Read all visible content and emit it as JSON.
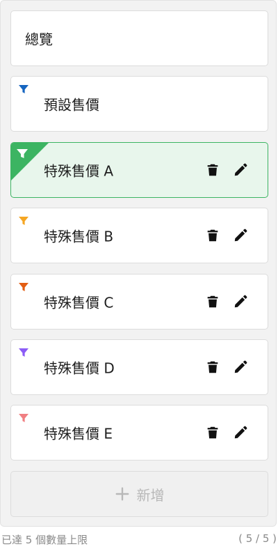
{
  "overview": {
    "label": "總覽"
  },
  "default_price": {
    "label": "預設售價",
    "color": "#1565c0"
  },
  "special_prices": [
    {
      "label": "特殊售價 A",
      "color": "#3cb462",
      "selected": true
    },
    {
      "label": "特殊售價 B",
      "color": "#f5a623",
      "selected": false
    },
    {
      "label": "特殊售價 C",
      "color": "#e35d12",
      "selected": false
    },
    {
      "label": "特殊售價 D",
      "color": "#8b5cf6",
      "selected": false
    },
    {
      "label": "特殊售價 E",
      "color": "#f07f82",
      "selected": false
    }
  ],
  "actions": {
    "delete_icon": "trash-icon",
    "edit_icon": "pencil-icon"
  },
  "add_button": {
    "label": "新增",
    "icon": "plus-icon",
    "disabled": true
  },
  "footer": {
    "limit_text": "已達 5 個數量上限",
    "count_text": "( 5 / 5 )"
  }
}
